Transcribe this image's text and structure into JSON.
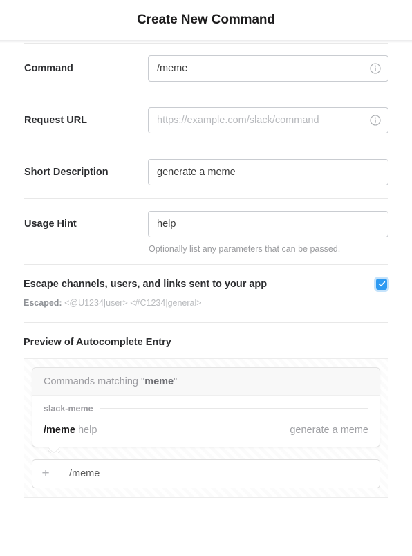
{
  "header": {
    "title": "Create New Command"
  },
  "fields": [
    {
      "label": "Command",
      "value": "/meme",
      "placeholder": "",
      "icon": "info-icon",
      "help": ""
    },
    {
      "label": "Request URL",
      "value": "",
      "placeholder": "https://example.com/slack/command",
      "icon": "info-icon",
      "help": ""
    },
    {
      "label": "Short Description",
      "value": "generate a meme",
      "placeholder": "",
      "icon": "",
      "help": ""
    },
    {
      "label": "Usage Hint",
      "value": "help",
      "placeholder": "",
      "icon": "",
      "help": "Optionally list any parameters that can be passed."
    }
  ],
  "escape": {
    "title": "Escape channels, users, and links sent to your app",
    "checked": true,
    "sample_label": "Escaped:",
    "sample_value": "<@U1234|user> <#C1234|general>",
    "checkbox_color": "#2e9af2",
    "checkmark": "✓"
  },
  "preview": {
    "heading": "Preview of Autocomplete Entry",
    "header_prefix": "Commands matching \"",
    "header_term": "meme",
    "header_suffix": "\"",
    "group_name": "slack-meme",
    "item_command": "/meme",
    "item_hint": "help",
    "item_description": "generate a meme",
    "composer_plus": "+",
    "composer_value": "/meme"
  }
}
